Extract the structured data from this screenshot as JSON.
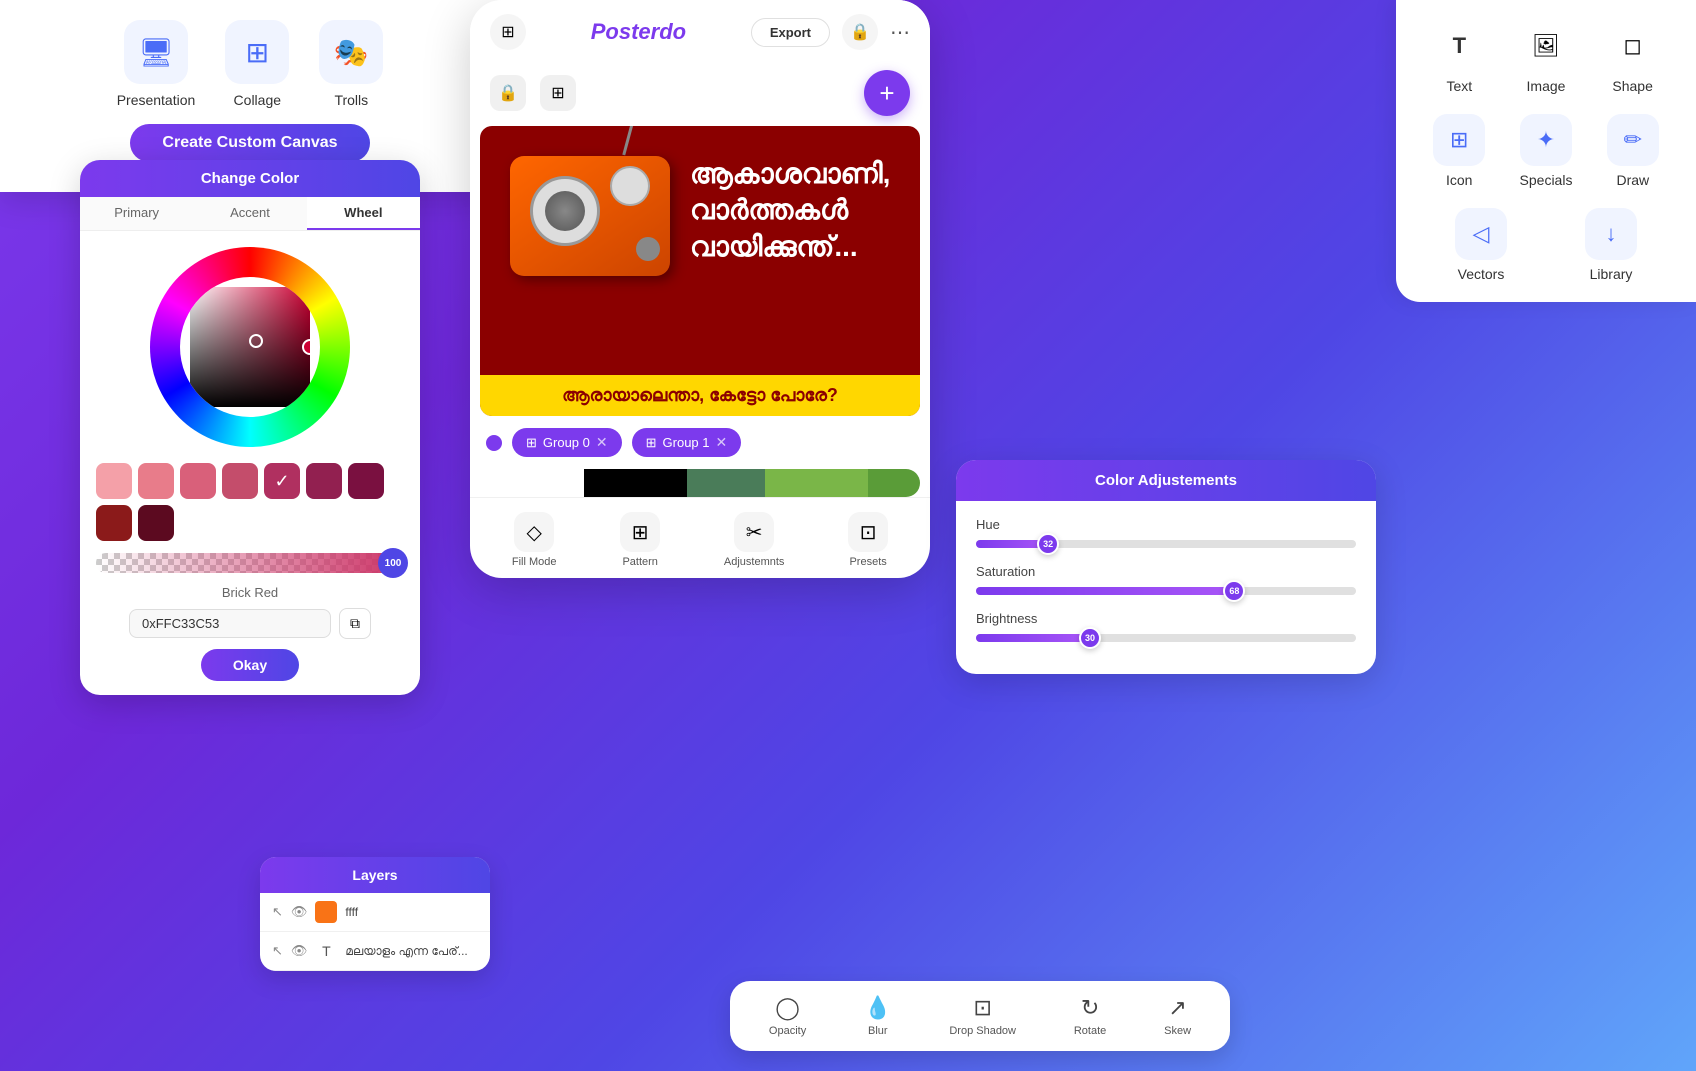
{
  "topLeftCard": {
    "items": [
      {
        "label": "Presentation",
        "icon": "🖥"
      },
      {
        "label": "Collage",
        "icon": "⊞"
      },
      {
        "label": "Trolls",
        "icon": "🎭"
      }
    ],
    "createBtn": "Create Custom Canvas"
  },
  "colorPicker": {
    "title": "Change Color",
    "tabs": [
      "Primary",
      "Accent",
      "Wheel"
    ],
    "activeTab": "Wheel",
    "swatches": [
      {
        "color": "#f4a0a8",
        "selected": false
      },
      {
        "color": "#e87c8a",
        "selected": false
      },
      {
        "color": "#d9607a",
        "selected": false
      },
      {
        "color": "#c44d6b",
        "selected": false
      },
      {
        "color": "#b03060",
        "selected": true
      },
      {
        "color": "#922050",
        "selected": false
      },
      {
        "color": "#7a1040",
        "selected": false
      },
      {
        "color": "#8B1A1A",
        "selected": false
      },
      {
        "color": "#5c0a20",
        "selected": false
      }
    ],
    "colorName": "Brick Red",
    "hexValue": "0xFFC33C53",
    "opacityValue": 100,
    "okayBtn": "Okay"
  },
  "phoneHeader": {
    "logo": "Posterdo",
    "exportBtn": "Export",
    "lockIcon": "🔒",
    "gridIcon": "⊞",
    "moreIcon": "⋯"
  },
  "canvas": {
    "malayalamLine1": "ആകാശവാണി,",
    "malayalamLine2": "വാർത്തകൾ",
    "malayalamLine3": "വായിക്കുന്ത്...",
    "yellowText": "ആരായാലെന്താ, കേട്ടോ പോരേ?"
  },
  "groups": [
    {
      "label": "Group 0",
      "id": 0
    },
    {
      "label": "Group 1",
      "id": 1
    }
  ],
  "bottomToolbar": {
    "items": [
      {
        "label": "Fill Mode",
        "icon": "◇"
      },
      {
        "label": "Pattern",
        "icon": "⊞"
      },
      {
        "label": "Adjustemnts",
        "icon": "✂"
      },
      {
        "label": "Presets",
        "icon": "⊡"
      }
    ]
  },
  "rightPanel": {
    "topItems": [
      {
        "label": "Text",
        "icon": "T"
      },
      {
        "label": "Image",
        "icon": "🖼"
      },
      {
        "label": "Shape",
        "icon": "◻"
      }
    ],
    "midItems": [
      {
        "label": "Icon",
        "icon": "⊞"
      },
      {
        "label": "Specials",
        "icon": "✦"
      },
      {
        "label": "Draw",
        "icon": "✏"
      }
    ],
    "botItems": [
      {
        "label": "Vectors",
        "icon": "◁"
      },
      {
        "label": "Library",
        "icon": "↓"
      }
    ]
  },
  "colorAdjCard": {
    "title": "Color Adjustements",
    "sliders": [
      {
        "label": "Hue",
        "value": 32,
        "percent": 19
      },
      {
        "label": "Saturation",
        "value": 68,
        "percent": 68
      },
      {
        "label": "Brightness",
        "value": 30,
        "percent": 30
      }
    ]
  },
  "layers": {
    "title": "Layers",
    "rows": [
      {
        "icon": "↖",
        "vis": "👁",
        "thumb": "🟧",
        "name": "ffff"
      },
      {
        "icon": "↖",
        "vis": "👁",
        "thumb": "T",
        "name": "മലയാളം എന്ന പേര്..."
      }
    ]
  },
  "bottomActions": {
    "items": [
      {
        "label": "Opacity",
        "icon": "◯"
      },
      {
        "label": "Blur",
        "icon": "💧"
      },
      {
        "label": "Drop Shadow",
        "icon": "⊡"
      },
      {
        "label": "Rotate",
        "icon": "↻"
      },
      {
        "label": "Skew",
        "icon": "↗"
      }
    ]
  }
}
